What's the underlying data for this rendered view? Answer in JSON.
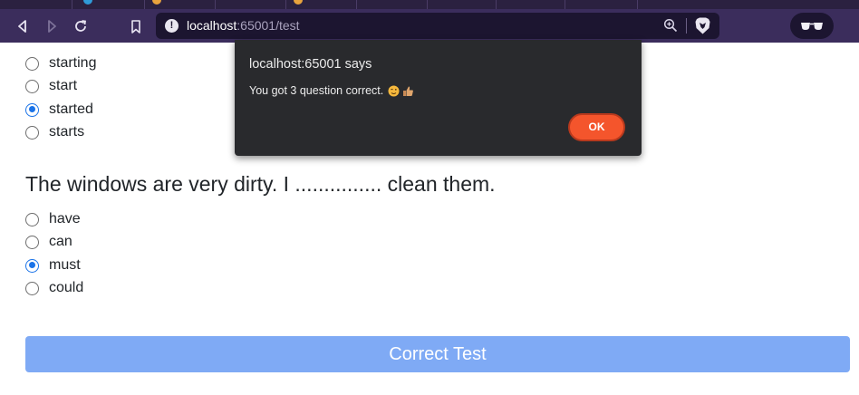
{
  "browser": {
    "url_host": "localhost",
    "url_port": ":65001",
    "url_path": "/test"
  },
  "questions": [
    {
      "options": [
        {
          "label": "starting",
          "checked": false
        },
        {
          "label": "start",
          "checked": false
        },
        {
          "label": "started",
          "checked": true
        },
        {
          "label": "starts",
          "checked": false
        }
      ]
    },
    {
      "text": "The windows are very dirty. I ............... clean them.",
      "options": [
        {
          "label": "have",
          "checked": false
        },
        {
          "label": "can",
          "checked": false
        },
        {
          "label": "must",
          "checked": true
        },
        {
          "label": "could",
          "checked": false
        }
      ]
    }
  ],
  "submit_label": "Correct Test",
  "dialog": {
    "title": "localhost:65001 says",
    "message": "You got  3 question correct.",
    "ok_label": "OK"
  },
  "colors": {
    "accent": "#1a73e8",
    "submit_bg": "#7faaf5",
    "ok_bg": "#f4552c",
    "dialog_bg": "#292a2d",
    "toolbar_bg": "#3b2d5c"
  }
}
